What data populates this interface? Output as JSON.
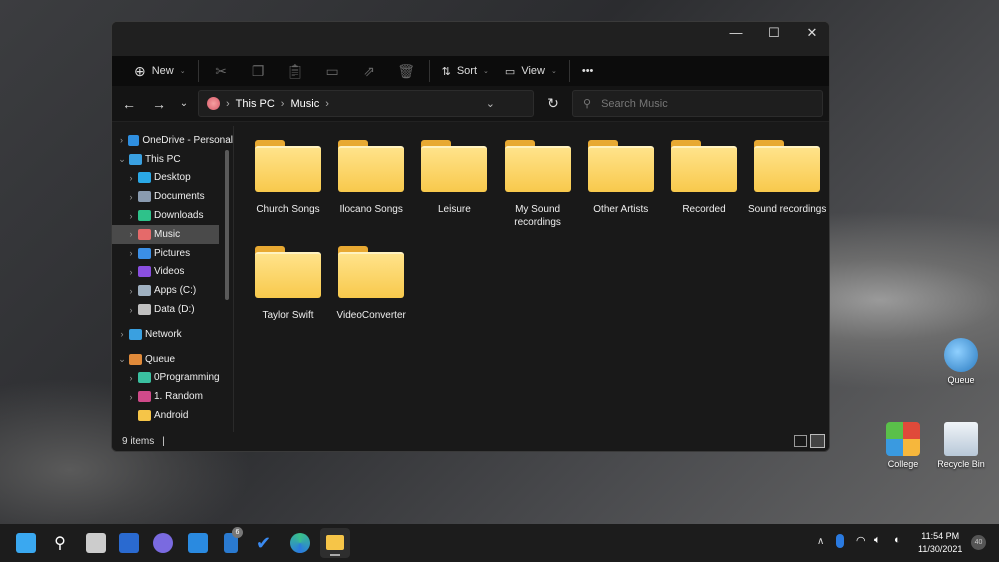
{
  "window": {
    "controls": {
      "minimize": "—",
      "maximize": "☐",
      "close": "✕"
    }
  },
  "toolbar": {
    "new_label": "New",
    "sort_label": "Sort",
    "view_label": "View",
    "more": "•••"
  },
  "address": {
    "crumbs": [
      "This PC",
      "Music"
    ],
    "search_placeholder": "Search Music"
  },
  "sidebar": {
    "items": [
      {
        "label": "OneDrive - Personal",
        "level": 0,
        "expanded": false,
        "color": "#2f8fe0"
      },
      {
        "label": "This PC",
        "level": 0,
        "expanded": true,
        "color": "#3aa0e0"
      },
      {
        "label": "Desktop",
        "level": 1,
        "color": "#2aa8e6"
      },
      {
        "label": "Documents",
        "level": 1,
        "color": "#8a9bb0"
      },
      {
        "label": "Downloads",
        "level": 1,
        "color": "#2ec28a"
      },
      {
        "label": "Music",
        "level": 1,
        "selected": true,
        "color": "#e56a6a"
      },
      {
        "label": "Pictures",
        "level": 1,
        "color": "#3b8fe6"
      },
      {
        "label": "Videos",
        "level": 1,
        "color": "#8a4fe0"
      },
      {
        "label": "Apps (C:)",
        "level": 1,
        "color": "#9fb0c0"
      },
      {
        "label": "Data (D:)",
        "level": 1,
        "color": "#c0c0c0"
      },
      {
        "label": "Network",
        "level": 0,
        "expanded": false,
        "color": "#3aa0e0"
      },
      {
        "label": "Queue",
        "level": 0,
        "expanded": true,
        "color": "#e08a3a"
      },
      {
        "label": "0Programming",
        "level": 1,
        "color": "#3ac0a0"
      },
      {
        "label": "1. Random",
        "level": 1,
        "color": "#d04a8a"
      },
      {
        "label": "Android",
        "level": 1,
        "nochev": true,
        "color": "#f6c548"
      }
    ]
  },
  "folders": [
    "Church Songs",
    "Ilocano Songs",
    "Leisure",
    "My Sound recordings",
    "Other Artists",
    "Recorded",
    "Sound recordings",
    "Taylor Swift",
    "VideoConverter"
  ],
  "status": {
    "count": "9 items"
  },
  "desktop_icons": [
    {
      "label": "Queue"
    },
    {
      "label": "College"
    },
    {
      "label": "Recycle Bin"
    }
  ],
  "taskbar": {
    "time": "11:54 PM",
    "date": "11/30/2021",
    "notification_count": "40",
    "store_badge": "6"
  }
}
